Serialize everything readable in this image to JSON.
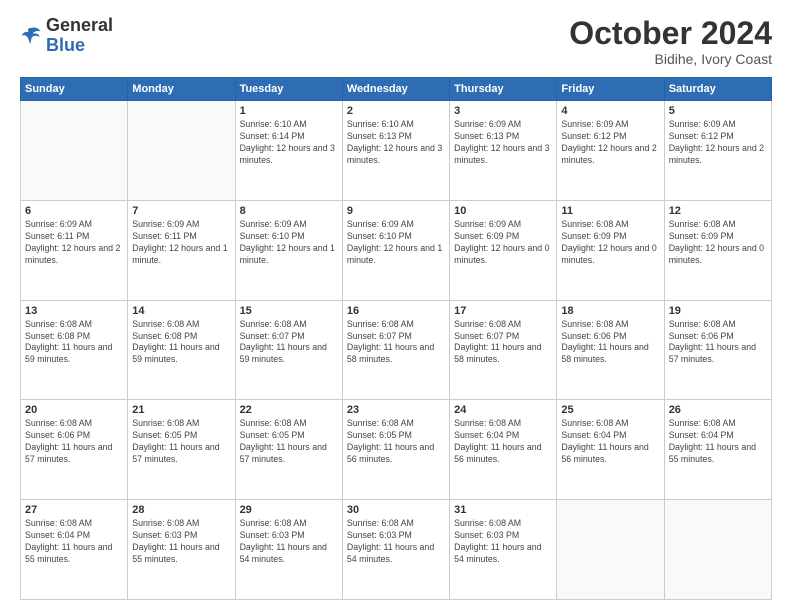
{
  "header": {
    "logo_general": "General",
    "logo_blue": "Blue",
    "month": "October 2024",
    "location": "Bidihe, Ivory Coast"
  },
  "weekdays": [
    "Sunday",
    "Monday",
    "Tuesday",
    "Wednesday",
    "Thursday",
    "Friday",
    "Saturday"
  ],
  "weeks": [
    [
      {
        "day": "",
        "info": ""
      },
      {
        "day": "",
        "info": ""
      },
      {
        "day": "1",
        "info": "Sunrise: 6:10 AM\nSunset: 6:14 PM\nDaylight: 12 hours\nand 3 minutes."
      },
      {
        "day": "2",
        "info": "Sunrise: 6:10 AM\nSunset: 6:13 PM\nDaylight: 12 hours\nand 3 minutes."
      },
      {
        "day": "3",
        "info": "Sunrise: 6:09 AM\nSunset: 6:13 PM\nDaylight: 12 hours\nand 3 minutes."
      },
      {
        "day": "4",
        "info": "Sunrise: 6:09 AM\nSunset: 6:12 PM\nDaylight: 12 hours\nand 2 minutes."
      },
      {
        "day": "5",
        "info": "Sunrise: 6:09 AM\nSunset: 6:12 PM\nDaylight: 12 hours\nand 2 minutes."
      }
    ],
    [
      {
        "day": "6",
        "info": "Sunrise: 6:09 AM\nSunset: 6:11 PM\nDaylight: 12 hours\nand 2 minutes."
      },
      {
        "day": "7",
        "info": "Sunrise: 6:09 AM\nSunset: 6:11 PM\nDaylight: 12 hours\nand 1 minute."
      },
      {
        "day": "8",
        "info": "Sunrise: 6:09 AM\nSunset: 6:10 PM\nDaylight: 12 hours\nand 1 minute."
      },
      {
        "day": "9",
        "info": "Sunrise: 6:09 AM\nSunset: 6:10 PM\nDaylight: 12 hours\nand 1 minute."
      },
      {
        "day": "10",
        "info": "Sunrise: 6:09 AM\nSunset: 6:09 PM\nDaylight: 12 hours\nand 0 minutes."
      },
      {
        "day": "11",
        "info": "Sunrise: 6:08 AM\nSunset: 6:09 PM\nDaylight: 12 hours\nand 0 minutes."
      },
      {
        "day": "12",
        "info": "Sunrise: 6:08 AM\nSunset: 6:09 PM\nDaylight: 12 hours\nand 0 minutes."
      }
    ],
    [
      {
        "day": "13",
        "info": "Sunrise: 6:08 AM\nSunset: 6:08 PM\nDaylight: 11 hours\nand 59 minutes."
      },
      {
        "day": "14",
        "info": "Sunrise: 6:08 AM\nSunset: 6:08 PM\nDaylight: 11 hours\nand 59 minutes."
      },
      {
        "day": "15",
        "info": "Sunrise: 6:08 AM\nSunset: 6:07 PM\nDaylight: 11 hours\nand 59 minutes."
      },
      {
        "day": "16",
        "info": "Sunrise: 6:08 AM\nSunset: 6:07 PM\nDaylight: 11 hours\nand 58 minutes."
      },
      {
        "day": "17",
        "info": "Sunrise: 6:08 AM\nSunset: 6:07 PM\nDaylight: 11 hours\nand 58 minutes."
      },
      {
        "day": "18",
        "info": "Sunrise: 6:08 AM\nSunset: 6:06 PM\nDaylight: 11 hours\nand 58 minutes."
      },
      {
        "day": "19",
        "info": "Sunrise: 6:08 AM\nSunset: 6:06 PM\nDaylight: 11 hours\nand 57 minutes."
      }
    ],
    [
      {
        "day": "20",
        "info": "Sunrise: 6:08 AM\nSunset: 6:06 PM\nDaylight: 11 hours\nand 57 minutes."
      },
      {
        "day": "21",
        "info": "Sunrise: 6:08 AM\nSunset: 6:05 PM\nDaylight: 11 hours\nand 57 minutes."
      },
      {
        "day": "22",
        "info": "Sunrise: 6:08 AM\nSunset: 6:05 PM\nDaylight: 11 hours\nand 57 minutes."
      },
      {
        "day": "23",
        "info": "Sunrise: 6:08 AM\nSunset: 6:05 PM\nDaylight: 11 hours\nand 56 minutes."
      },
      {
        "day": "24",
        "info": "Sunrise: 6:08 AM\nSunset: 6:04 PM\nDaylight: 11 hours\nand 56 minutes."
      },
      {
        "day": "25",
        "info": "Sunrise: 6:08 AM\nSunset: 6:04 PM\nDaylight: 11 hours\nand 56 minutes."
      },
      {
        "day": "26",
        "info": "Sunrise: 6:08 AM\nSunset: 6:04 PM\nDaylight: 11 hours\nand 55 minutes."
      }
    ],
    [
      {
        "day": "27",
        "info": "Sunrise: 6:08 AM\nSunset: 6:04 PM\nDaylight: 11 hours\nand 55 minutes."
      },
      {
        "day": "28",
        "info": "Sunrise: 6:08 AM\nSunset: 6:03 PM\nDaylight: 11 hours\nand 55 minutes."
      },
      {
        "day": "29",
        "info": "Sunrise: 6:08 AM\nSunset: 6:03 PM\nDaylight: 11 hours\nand 54 minutes."
      },
      {
        "day": "30",
        "info": "Sunrise: 6:08 AM\nSunset: 6:03 PM\nDaylight: 11 hours\nand 54 minutes."
      },
      {
        "day": "31",
        "info": "Sunrise: 6:08 AM\nSunset: 6:03 PM\nDaylight: 11 hours\nand 54 minutes."
      },
      {
        "day": "",
        "info": ""
      },
      {
        "day": "",
        "info": ""
      }
    ]
  ]
}
